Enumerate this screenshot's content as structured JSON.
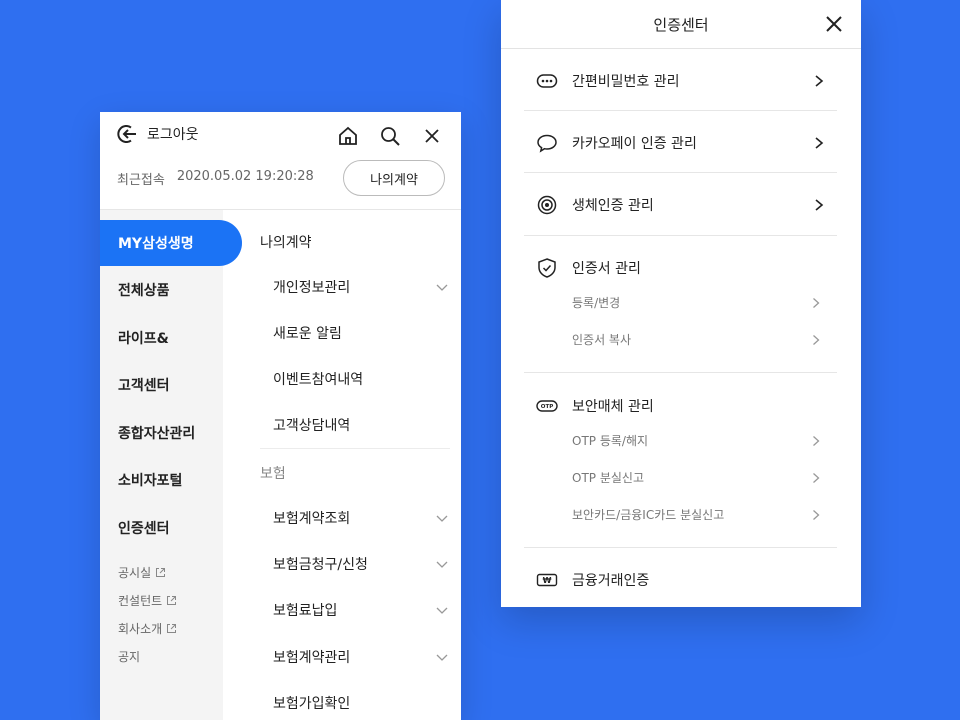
{
  "left": {
    "logout_label": "로그아웃",
    "recent_label": "최근접속",
    "recent_time": "2020.05.02 19:20:28",
    "contract_button": "나의계약",
    "nav": [
      "MY삼성생명",
      "전체상품",
      "라이프&",
      "고객센터",
      "종합자산관리",
      "소비자포털",
      "인증센터"
    ],
    "nav_sub": [
      "공시실",
      "컨설턴트",
      "회사소개",
      "공지"
    ],
    "section1": "나의계약",
    "items1": [
      "개인정보관리",
      "새로운 알림",
      "이벤트참여내역",
      "고객상담내역"
    ],
    "section2": "보험",
    "items2": [
      "보험계약조회",
      "보험금청구/신청",
      "보험료납입",
      "보험계약관리",
      "보험가입확인"
    ]
  },
  "right": {
    "title": "인증센터",
    "rows": {
      "simple_pw": "간편비밀번호 관리",
      "kakaopay": "카카오페이 인증 관리",
      "bio": "생체인증 관리",
      "cert": "인증서 관리",
      "security": "보안매체 관리",
      "finance": "금융거래인증"
    },
    "cert_sub": [
      "등록/변경",
      "인증서 복사"
    ],
    "security_sub": [
      "OTP 등록/해지",
      "OTP 분실신고",
      "보안카드/금융IC카드 분실신고"
    ],
    "otp_badge": "OTP",
    "won_badge": "₩"
  },
  "colors": {
    "background": "#2f6ff0",
    "accent": "#1b73f5"
  }
}
